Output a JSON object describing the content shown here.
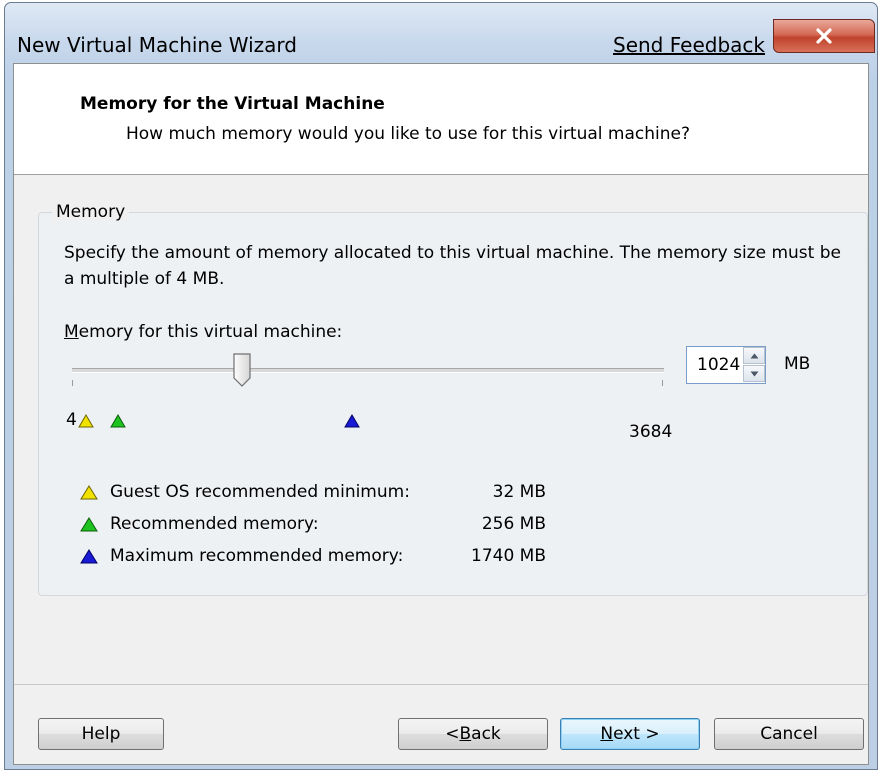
{
  "window": {
    "title": "New Virtual Machine Wizard",
    "feedback_link": "Send Feedback",
    "close_label": "X"
  },
  "header": {
    "title": "Memory for the Virtual Machine",
    "subtitle": "How much memory would you like to use for this virtual machine?"
  },
  "memory_group": {
    "label": "Memory",
    "description": "Specify the amount of memory allocated to this virtual machine. The memory size must be a multiple of 4 MB.",
    "field_label_accel": "M",
    "field_label_rest": "emory for this virtual machine:",
    "value": "1024",
    "unit": "MB",
    "slider": {
      "min_label": "4",
      "max_label": "3684",
      "min": 4,
      "max": 3684,
      "value": 1024
    },
    "legend": [
      {
        "label": "Guest OS recommended minimum:",
        "value": "32 MB",
        "color": "#f2e200",
        "icon": "yellow-triangle-icon"
      },
      {
        "label": "Recommended memory:",
        "value": "256 MB",
        "color": "#1fc31f",
        "icon": "green-triangle-icon"
      },
      {
        "label": "Maximum recommended memory:",
        "value": "1740 MB",
        "color": "#1a1ad6",
        "icon": "blue-triangle-icon"
      }
    ]
  },
  "buttons": {
    "help": "Help",
    "back_prefix": "< ",
    "back_accel": "B",
    "back_rest": "ack",
    "next_accel": "N",
    "next_rest": "ext >",
    "cancel": "Cancel"
  }
}
